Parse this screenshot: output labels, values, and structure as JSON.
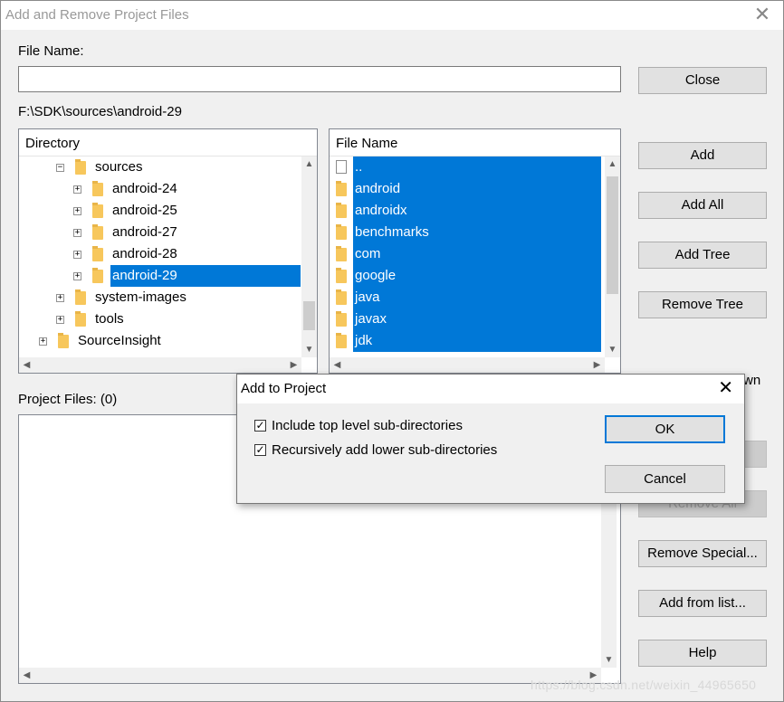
{
  "window": {
    "title": "Add and Remove Project Files",
    "close_glyph": "✕"
  },
  "file_name": {
    "label": "File Name:",
    "value": ""
  },
  "current_path": "F:\\SDK\\sources\\android-29",
  "directory": {
    "header": "Directory",
    "items": [
      {
        "label": "sources",
        "expander": "⊟"
      },
      {
        "label": "android-24",
        "expander": "⊞"
      },
      {
        "label": "android-25",
        "expander": "⊞"
      },
      {
        "label": "android-27",
        "expander": "⊞"
      },
      {
        "label": "android-28",
        "expander": "⊞"
      },
      {
        "label": "android-29",
        "expander": "⊞",
        "selected": true
      },
      {
        "label": "system-images",
        "expander": "⊞"
      },
      {
        "label": "tools",
        "expander": "⊞"
      },
      {
        "label": "SourceInsight",
        "expander": "⊞"
      }
    ]
  },
  "file_list": {
    "header": "File Name",
    "items": [
      {
        "label": "..",
        "icon": "file-icon"
      },
      {
        "label": "android",
        "icon": "folder-icon"
      },
      {
        "label": "androidx",
        "icon": "folder-icon"
      },
      {
        "label": "benchmarks",
        "icon": "folder-icon"
      },
      {
        "label": "com",
        "icon": "folder-icon"
      },
      {
        "label": "google",
        "icon": "folder-icon"
      },
      {
        "label": "java",
        "icon": "folder-icon"
      },
      {
        "label": "javax",
        "icon": "folder-icon"
      },
      {
        "label": "jdk",
        "icon": "folder-icon"
      }
    ]
  },
  "project_files": {
    "label": "Project Files: (0)"
  },
  "buttons": {
    "close": "Close",
    "add": "Add",
    "add_all": "Add All",
    "add_tree": "Add Tree",
    "remove_tree": "Remove Tree",
    "remove_all": "Remove All",
    "remove_special": "Remove Special...",
    "add_from_list": "Add from list...",
    "help": "Help"
  },
  "partial_text": "wn",
  "dialog": {
    "title": "Add to Project",
    "close_glyph": "✕",
    "options": [
      {
        "label": "Include top level sub-directories",
        "checked": true
      },
      {
        "label": "Recursively add lower sub-directories",
        "checked": true
      }
    ],
    "ok": "OK",
    "cancel": "Cancel"
  },
  "watermark": "https://blog.csdn.net/weixin_44965650",
  "colors": {
    "selection": "#0078d7",
    "folder": "#f7c75c"
  }
}
